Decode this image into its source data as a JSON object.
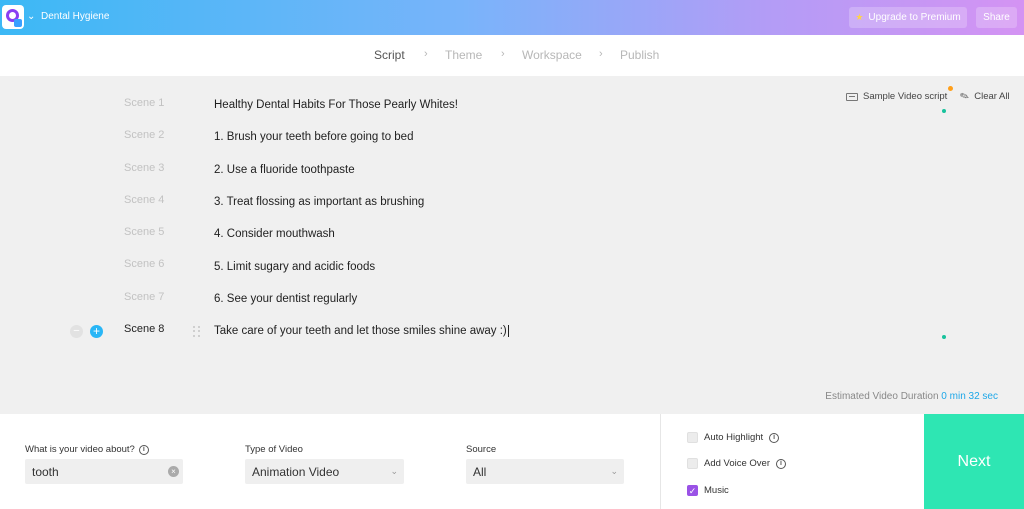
{
  "header": {
    "project_title": "Dental Hygiene",
    "upgrade_label": "Upgrade to Premium",
    "share_label": "Share"
  },
  "steps": [
    {
      "label": "Script",
      "active": true
    },
    {
      "label": "Theme",
      "active": false
    },
    {
      "label": "Workspace",
      "active": false
    },
    {
      "label": "Publish",
      "active": false
    }
  ],
  "scenes": [
    {
      "label": "Scene 1",
      "text": "Healthy Dental Habits For Those Pearly Whites!"
    },
    {
      "label": "Scene 2",
      "text": "1. Brush your teeth before going to bed"
    },
    {
      "label": "Scene 3",
      "text": "2. Use a fluoride toothpaste"
    },
    {
      "label": "Scene 4",
      "text": "3. Treat flossing as important as brushing"
    },
    {
      "label": "Scene 5",
      "text": "4. Consider mouthwash"
    },
    {
      "label": "Scene 6",
      "text": "5. Limit sugary and acidic foods"
    },
    {
      "label": "Scene 7",
      "text": "6. See your dentist regularly"
    },
    {
      "label": "Scene 8",
      "text": "Take care of your teeth and let those smiles shine away :)"
    }
  ],
  "toolbar": {
    "sample_script_label": "Sample Video script",
    "clear_all_label": "Clear All"
  },
  "duration": {
    "label": "Estimated Video Duration",
    "value": "0 min 32 sec"
  },
  "form": {
    "about_label": "What is your video about?",
    "about_value": "tooth",
    "type_label": "Type of Video",
    "type_value": "Animation Video",
    "source_label": "Source",
    "source_value": "All"
  },
  "options": [
    {
      "label": "Auto Highlight",
      "checked": false,
      "info": true
    },
    {
      "label": "Add Voice Over",
      "checked": false,
      "info": true
    },
    {
      "label": "Music",
      "checked": true,
      "info": false
    }
  ],
  "next_label": "Next",
  "colors": {
    "accent_blue": "#1da7e8",
    "next_green": "#2ee6b3",
    "checkbox_purple": "#9a52e6"
  }
}
